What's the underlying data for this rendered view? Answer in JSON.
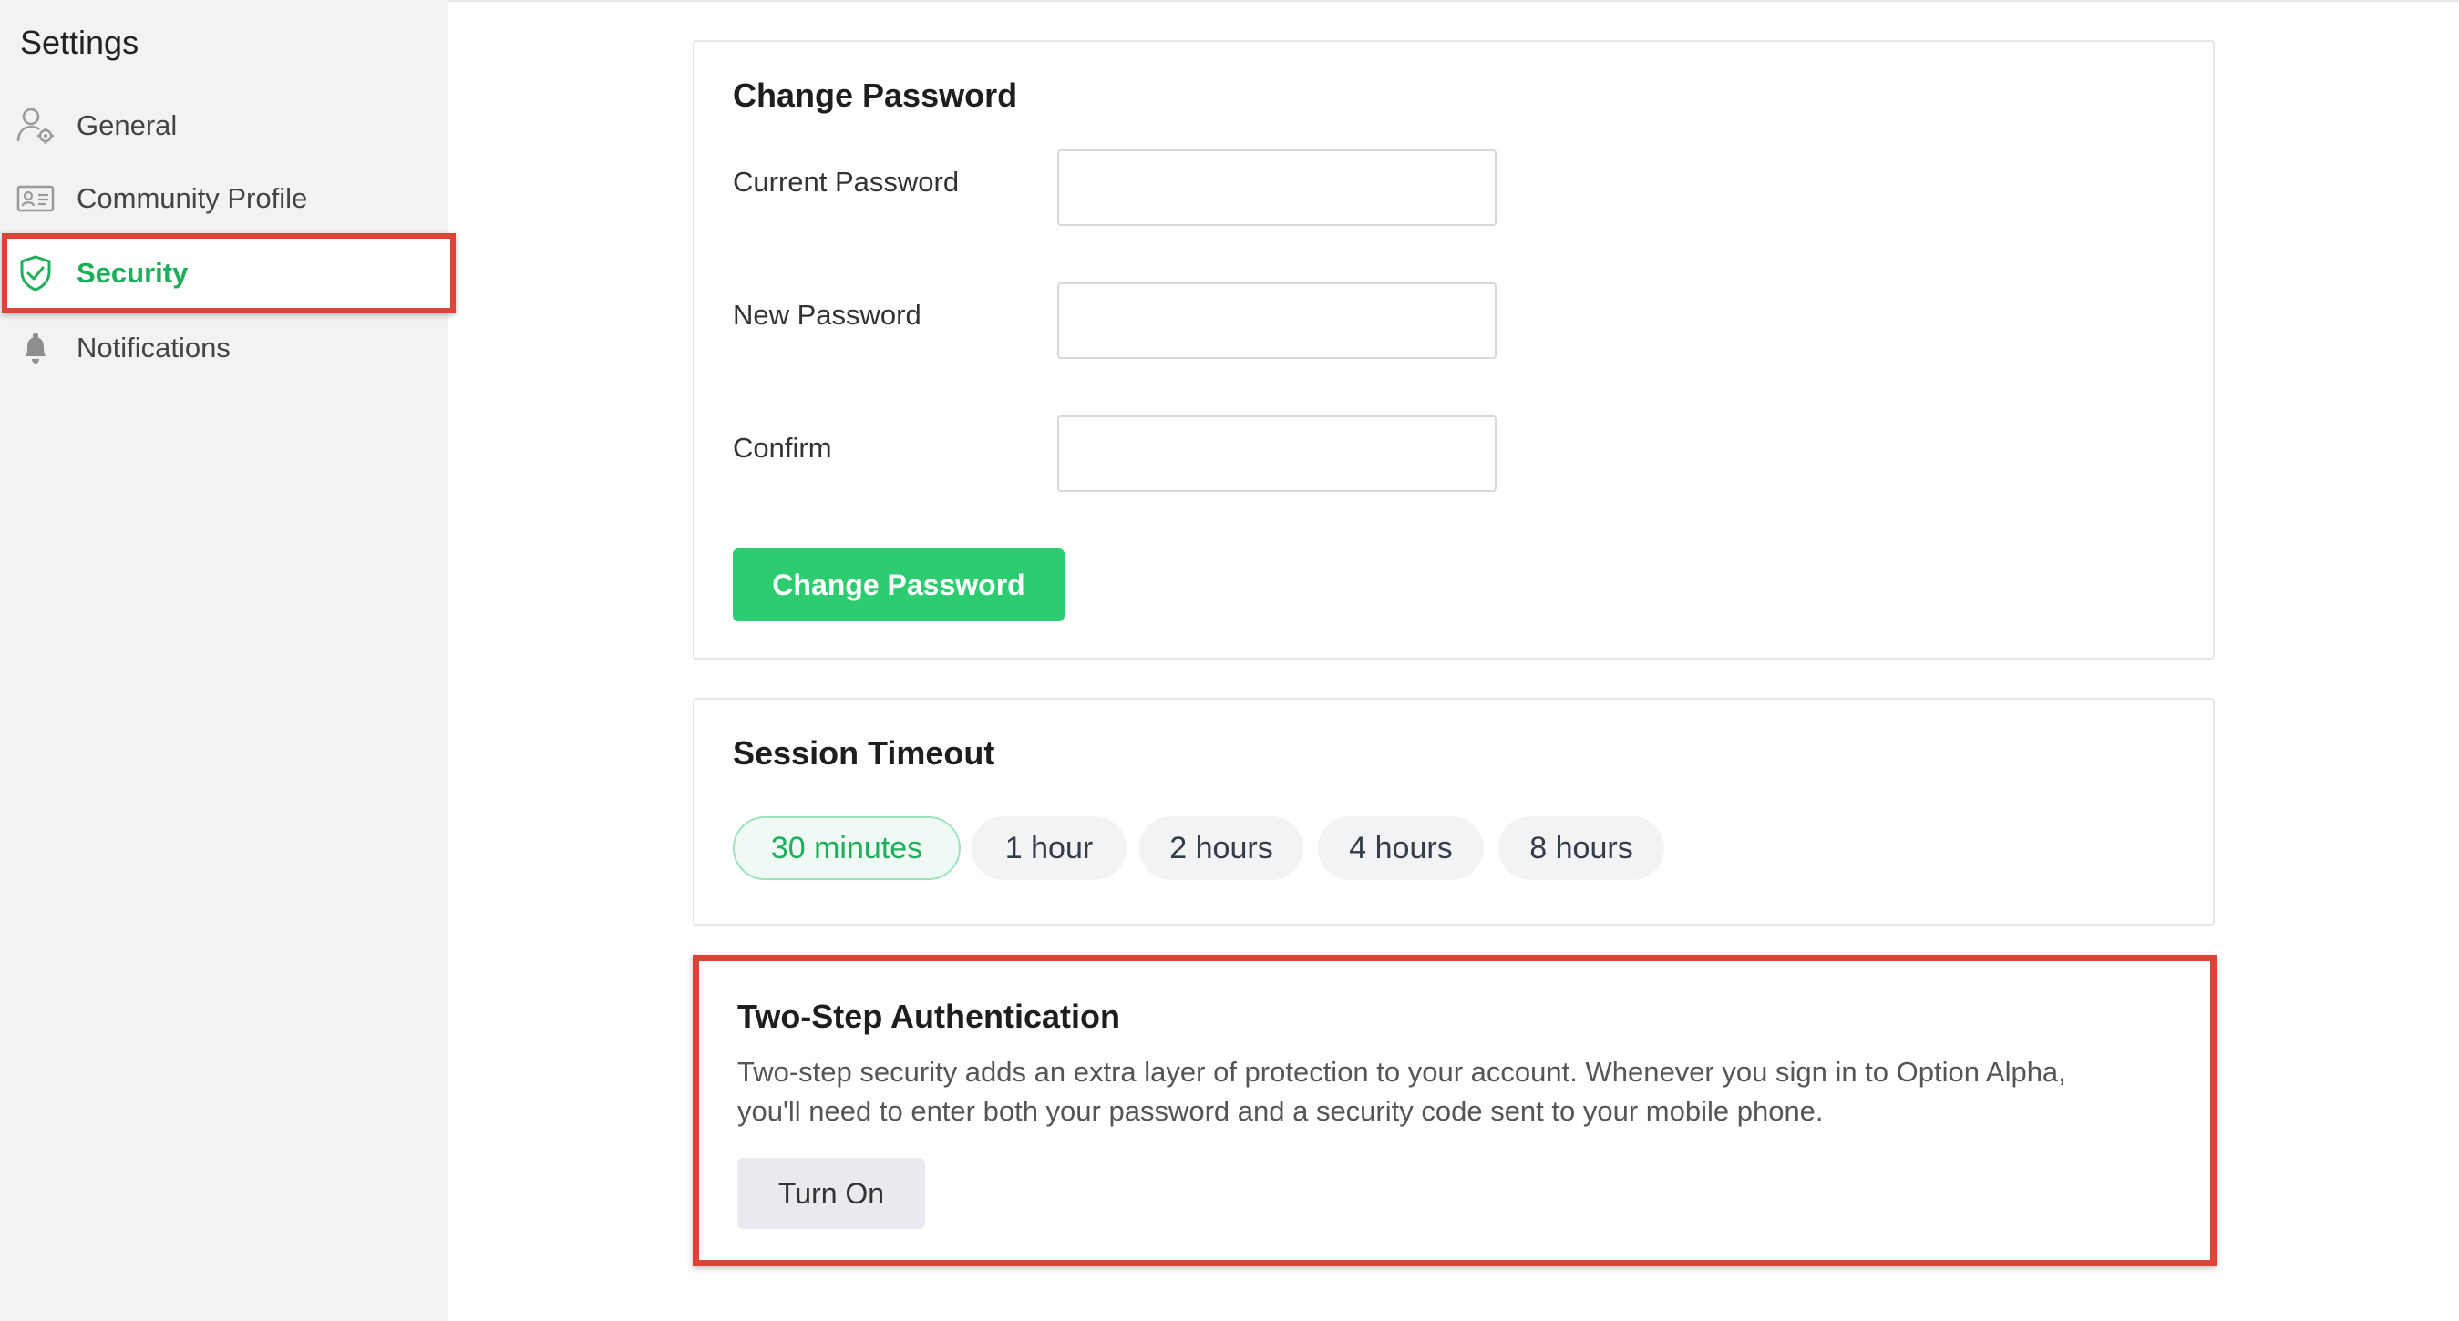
{
  "sidebar": {
    "title": "Settings",
    "items": [
      {
        "label": "General",
        "icon": "user-gear-icon",
        "active": false
      },
      {
        "label": "Community Profile",
        "icon": "id-card-icon",
        "active": false
      },
      {
        "label": "Security",
        "icon": "shield-check-icon",
        "active": true
      },
      {
        "label": "Notifications",
        "icon": "bell-icon",
        "active": false
      }
    ]
  },
  "change_password": {
    "title": "Change Password",
    "fields": [
      {
        "label": "Current Password",
        "value": "",
        "placeholder": ""
      },
      {
        "label": "New Password",
        "value": "",
        "placeholder": ""
      },
      {
        "label": "Confirm",
        "value": "",
        "placeholder": ""
      }
    ],
    "button_label": "Change Password"
  },
  "session_timeout": {
    "title": "Session Timeout",
    "options": [
      "30 minutes",
      "1 hour",
      "2 hours",
      "4 hours",
      "8 hours"
    ],
    "selected": "30 minutes"
  },
  "two_step": {
    "title": "Two-Step Authentication",
    "description_line1": "Two-step security adds an extra layer of protection to your account. Whenever you sign in to Option Alpha,",
    "description_line2": "you'll need to enter both your password and a security code sent to your mobile phone.",
    "button_label": "Turn On"
  },
  "colors": {
    "accent_green": "#2ecc71",
    "active_text_green": "#1fae5b",
    "highlight_red": "#dc4437",
    "sidebar_bg": "#f2f2f2"
  }
}
